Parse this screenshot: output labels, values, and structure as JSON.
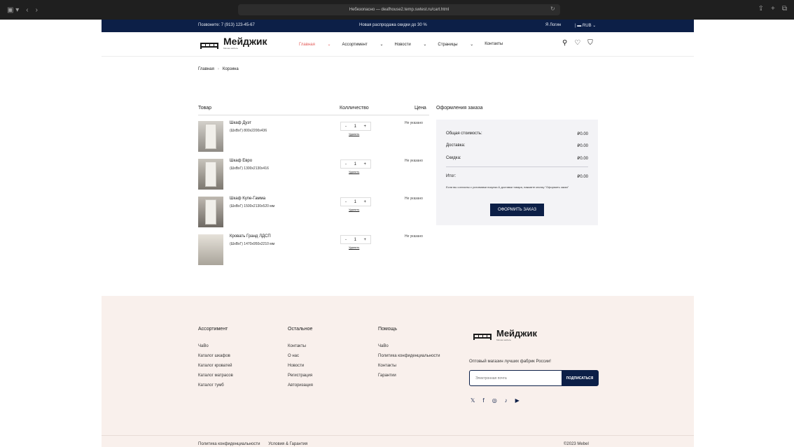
{
  "browser": {
    "url_text": "Небезопасно — deafhouse2.temp.swtest.ru/cart.html"
  },
  "topbar": {
    "phone": "Позвоните: 7 (913) 123-45-67",
    "promo": "Новая распродажа скидки до 30 %",
    "login": "Я Логин",
    "lang": "RUB"
  },
  "header": {
    "logo_name": "Мейджик",
    "logo_tag": "Мягкая мебель",
    "nav": [
      "Главная",
      "Ассортимент",
      "Новости",
      "Страницы",
      "Контакты"
    ]
  },
  "breadcrumb": {
    "home": "Главная",
    "current": "Корзина"
  },
  "cart": {
    "col_product": "Товар",
    "col_qty": "Колличество",
    "col_price": "Цена",
    "remove_label": "Удалить",
    "items": [
      {
        "name": "Шкаф Дуэт",
        "dims": "(ШхВхГ) 800х2200х436",
        "qty": "1",
        "price": "Не указано"
      },
      {
        "name": "Шкаф Евро",
        "dims": "(ШхВхГ) 1300х2130х416",
        "qty": "1",
        "price": "Не указано"
      },
      {
        "name": "Шкаф Купе-Гамма",
        "dims": "(ШхВхГ) 1500х2130х520 мм",
        "qty": "1",
        "price": "Не указано"
      },
      {
        "name": "Кровать Гранд ЛДСП",
        "dims": "(ШхВхГ) 1470х950х2210 мм",
        "qty": "1",
        "price": "Не указано"
      }
    ]
  },
  "summary": {
    "title": "Оформления заказа",
    "total_label": "Общая стоимость:",
    "total_value": "₽0.00",
    "delivery_label": "Доставка:",
    "delivery_value": "₽0.00",
    "discount_label": "Скидка:",
    "discount_value": "₽0.00",
    "result_label": "Итог:",
    "result_value": "₽0.00",
    "note": "Если вы согласны с условиями покупки & доставки товара, нажмите кнопку \"Оформить заказ\"",
    "checkout_label": "ОФОРМИТЬ ЗАКАЗ"
  },
  "footer": {
    "col1": {
      "title": "Ассортимент",
      "items": [
        "ЧаВо",
        "Каталог шкафов",
        "Каталог кроватей",
        "Каталог матрасов",
        "Каталог тумб"
      ]
    },
    "col2": {
      "title": "Остальное",
      "items": [
        "Контакты",
        "О нас",
        "Новости",
        "Регистрация",
        "Авторизация"
      ]
    },
    "col3": {
      "title": "Помощь",
      "items": [
        "ЧаВо",
        "Политика конфиденциальности",
        "Контакты",
        "Гарантии"
      ]
    },
    "logo_name": "Мейджик",
    "logo_tag": "Мягкая мебель",
    "desc": "Оптовый магазин лучших фабрик России!",
    "email_placeholder": "Электронная почта",
    "subscribe_label": "ПОДПИСАТЬСЯ",
    "bottom_links": [
      "Политика конфиденциальности",
      "Условия & Гарантия"
    ],
    "copyright": "©2023 Mebel"
  },
  "colors": {
    "navy": "#0c1f47",
    "accent": "#e35b58",
    "footer_bg": "#f9f0ec",
    "summary_bg": "#f3f3f6"
  }
}
